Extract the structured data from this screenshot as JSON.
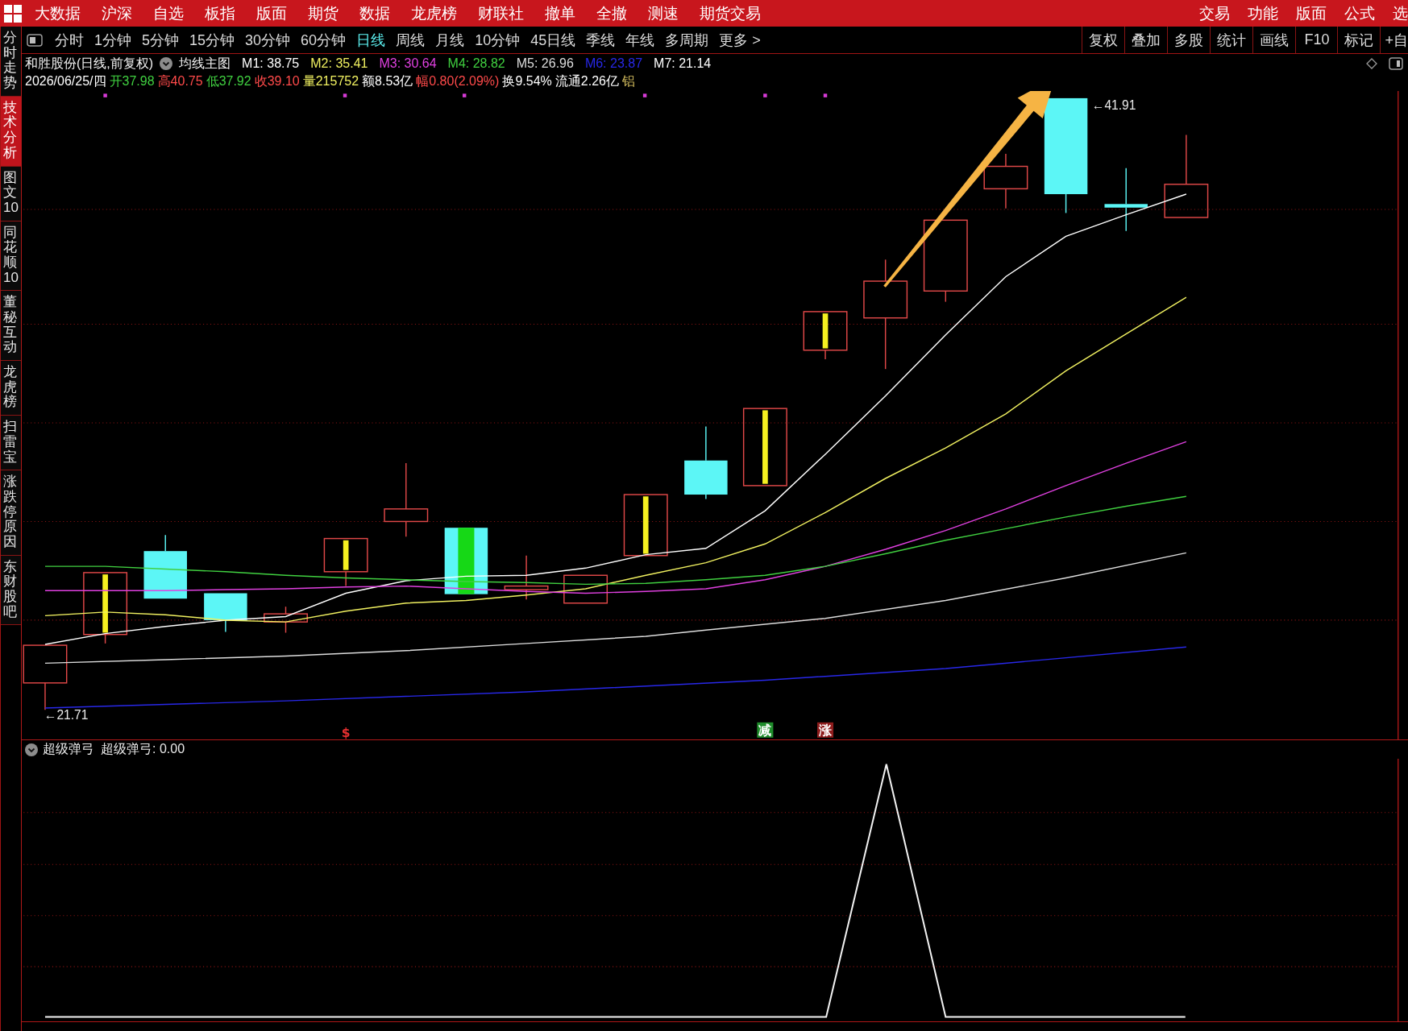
{
  "menu_bar": {
    "items": [
      "大数据",
      "沪深",
      "自选",
      "板指",
      "版面",
      "期货",
      "数据",
      "龙虎榜",
      "财联社",
      "撤单",
      "全撤",
      "测速",
      "期货交易"
    ],
    "right_items": [
      "交易",
      "功能",
      "版面",
      "公式",
      "选"
    ]
  },
  "sidebar": {
    "items": [
      {
        "label": "分时走势",
        "selected": false
      },
      {
        "label": "技术分析",
        "selected": true
      },
      {
        "label": "图文10",
        "selected": false
      },
      {
        "label": "同花顺10",
        "selected": false
      },
      {
        "label": "董秘互动",
        "selected": false
      },
      {
        "label": "龙虎榜",
        "selected": false
      },
      {
        "label": "扫雷宝",
        "selected": false
      },
      {
        "label": "涨跌停原因",
        "selected": false
      },
      {
        "label": "东财股吧",
        "selected": false
      }
    ]
  },
  "toolbar": {
    "periods": [
      {
        "label": "分时",
        "selected": false
      },
      {
        "label": "1分钟",
        "selected": false
      },
      {
        "label": "5分钟",
        "selected": false
      },
      {
        "label": "15分钟",
        "selected": false
      },
      {
        "label": "30分钟",
        "selected": false
      },
      {
        "label": "60分钟",
        "selected": false
      },
      {
        "label": "日线",
        "selected": true
      },
      {
        "label": "周线",
        "selected": false
      },
      {
        "label": "月线",
        "selected": false
      },
      {
        "label": "10分钟",
        "selected": false
      },
      {
        "label": "45日线",
        "selected": false
      },
      {
        "label": "季线",
        "selected": false
      },
      {
        "label": "年线",
        "selected": false
      },
      {
        "label": "多周期",
        "selected": false
      }
    ],
    "more": "更多 >",
    "tools": [
      "复权",
      "叠加",
      "多股",
      "统计",
      "画线",
      "F10",
      "标记",
      "+自"
    ]
  },
  "main_chart": {
    "stock": "和胜股份(日线,前复权)",
    "indicator": "均线主图",
    "averages": [
      {
        "label": "M1: 38.75",
        "color": "#ffffff"
      },
      {
        "label": "M2: 35.41",
        "color": "#f0f060"
      },
      {
        "label": "M3: 30.64",
        "color": "#e040e0"
      },
      {
        "label": "M4: 28.82",
        "color": "#40d040"
      },
      {
        "label": "M5: 26.96",
        "color": "#dddddd"
      },
      {
        "label": "M6: 23.87",
        "color": "#2828e8"
      },
      {
        "label": "M7: 21.14",
        "color": "#ffffff"
      }
    ],
    "quote": [
      {
        "text": "2026/06/25/四",
        "color": "#ffffff"
      },
      {
        "text": "开37.98",
        "color": "#40d040"
      },
      {
        "text": "高40.75",
        "color": "#ff4a4a"
      },
      {
        "text": "低37.92",
        "color": "#40d040"
      },
      {
        "text": "收39.10",
        "color": "#ff4a4a"
      },
      {
        "text": "量215752",
        "color": "#f0f060"
      },
      {
        "text": "额8.53亿",
        "color": "#ffffff"
      },
      {
        "text": "幅0.80(2.09%)",
        "color": "#ff4a4a"
      },
      {
        "text": "换9.54%",
        "color": "#ffffff"
      },
      {
        "text": "流通2.26亿",
        "color": "#ffffff"
      },
      {
        "text": "铝",
        "color": "#d8c060"
      }
    ],
    "high_label": "←41.91",
    "low_label": "←21.71",
    "signals": [
      {
        "kind": "dollar",
        "text": "$"
      },
      {
        "kind": "reduce",
        "text": "减"
      },
      {
        "kind": "rise",
        "text": "涨"
      }
    ]
  },
  "sub_chart": {
    "name": "超级弹弓",
    "readout": "超级弹弓: 0.00"
  }
}
